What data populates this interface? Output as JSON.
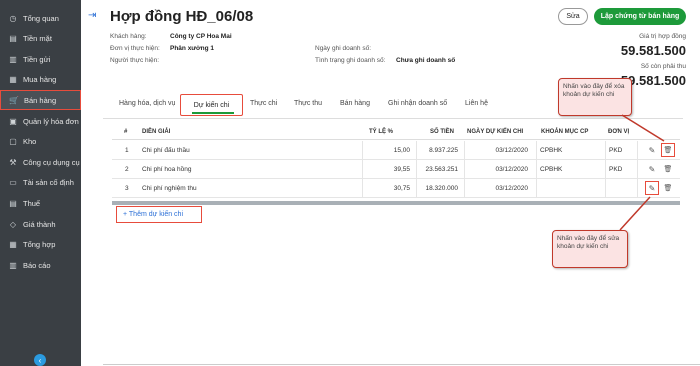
{
  "sidebar": {
    "items": [
      {
        "label": "Tổng quan",
        "icon": "dashboard-icon",
        "glyph": "◷"
      },
      {
        "label": "Tiền mặt",
        "icon": "cash-icon",
        "glyph": "▤"
      },
      {
        "label": "Tiền gửi",
        "icon": "bank-icon",
        "glyph": "▥"
      },
      {
        "label": "Mua hàng",
        "icon": "purchase-icon",
        "glyph": "▦"
      },
      {
        "label": "Bán hàng",
        "icon": "cart-icon",
        "glyph": "🛒"
      },
      {
        "label": "Quản lý hóa đơn",
        "icon": "invoice-icon",
        "glyph": "▣"
      },
      {
        "label": "Kho",
        "icon": "warehouse-icon",
        "glyph": "▢"
      },
      {
        "label": "Công cụ dụng cụ",
        "icon": "tools-icon",
        "glyph": "⚒"
      },
      {
        "label": "Tài sản cố định",
        "icon": "asset-icon",
        "glyph": "▭"
      },
      {
        "label": "Thuế",
        "icon": "tax-icon",
        "glyph": "▤"
      },
      {
        "label": "Giá thành",
        "icon": "price-tag-icon",
        "glyph": "◇"
      },
      {
        "label": "Tổng hợp",
        "icon": "summary-icon",
        "glyph": "▦"
      },
      {
        "label": "Báo cáo",
        "icon": "report-icon",
        "glyph": "▥"
      }
    ],
    "active_index": 4
  },
  "header": {
    "title": "Hợp đồng HĐ_06/08",
    "edit_label": "Sửa",
    "primary_label": "Lập chứng từ bán hàng"
  },
  "info": {
    "customer_label": "Khách hàng:",
    "customer_value": "Công ty CP Hoa Mai",
    "unit_label": "Đơn vị thực hiện:",
    "unit_value": "Phân xưởng 1",
    "person_label": "Người thực hiện:",
    "date_label": "Ngày ghi doanh số:",
    "status_label": "Tình trạng ghi doanh số:",
    "status_value": "Chưa ghi doanh số"
  },
  "values": {
    "contract_label": "Giá trị hợp đồng",
    "contract_value": "59.581.500",
    "remaining_label": "Số còn phải thu",
    "remaining_value": "59.581.500"
  },
  "tabs": [
    "Hàng hóa, dịch vụ",
    "Dự kiến chi",
    "Thực chi",
    "Thực thu",
    "Bán hàng",
    "Ghi nhận doanh số",
    "Liên hệ"
  ],
  "table": {
    "headers": [
      "#",
      "DIỄN GIẢI",
      "TỶ LỆ %",
      "SỐ TIỀN",
      "NGÀY DỰ KIẾN CHI",
      "KHOẢN MỤC CP",
      "ĐƠN VỊ"
    ],
    "rows": [
      {
        "no": "1",
        "desc": "Chi phí đấu thầu",
        "rate": "15,00",
        "amount": "8.937.225",
        "date": "03/12/2020",
        "cost_item": "CPBHK",
        "unit": "PKD"
      },
      {
        "no": "2",
        "desc": "Chi phí hoa hồng",
        "rate": "39,55",
        "amount": "23.563.251",
        "date": "03/12/2020",
        "cost_item": "CPBHK",
        "unit": "PKD"
      },
      {
        "no": "3",
        "desc": "Chi phí nghiệm thu",
        "rate": "30,75",
        "amount": "18.320.000",
        "date": "03/12/2020",
        "cost_item": "",
        "unit": ""
      }
    ]
  },
  "add_label": "+ Thêm dự kiến chi",
  "callouts": {
    "delete_note": "Nhấn vào đây để xóa khoản dự kiến chi",
    "edit_note": "Nhấn vào đây để sửa khoản dự kiến chi"
  },
  "colors": {
    "sidebar_bg": "#3a3f44",
    "primary_green": "#1d9a3a",
    "highlight_red": "#e74c3c",
    "link_blue": "#2b6fd6"
  }
}
